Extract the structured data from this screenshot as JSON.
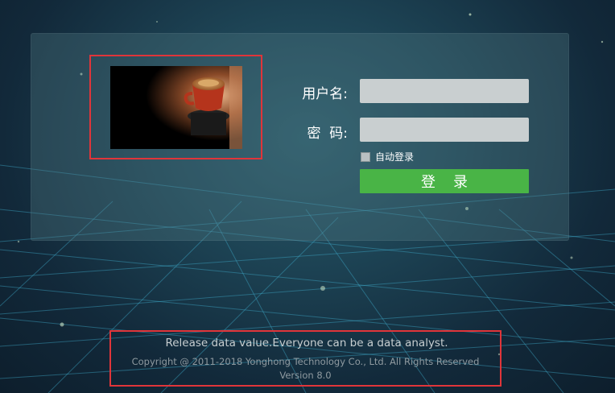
{
  "login": {
    "username_label": "用户名:",
    "password_label": "密  码:",
    "username_value": "",
    "password_value": "",
    "auto_login_label": "自动登录",
    "auto_login_checked": false,
    "submit_label": "登录"
  },
  "logo": {
    "icon": "coffee-cup-image"
  },
  "footer": {
    "slogan": "Release data value.Everyone can be a data analyst.",
    "copyright": "Copyright @ 2011-2018 Yonghong Technology Co., Ltd. All Rights Reserved",
    "version": "Version 8.0"
  },
  "colors": {
    "accent_button": "#49b446",
    "highlight_frame": "#e0353a",
    "input_background": "#c9cfd0"
  }
}
